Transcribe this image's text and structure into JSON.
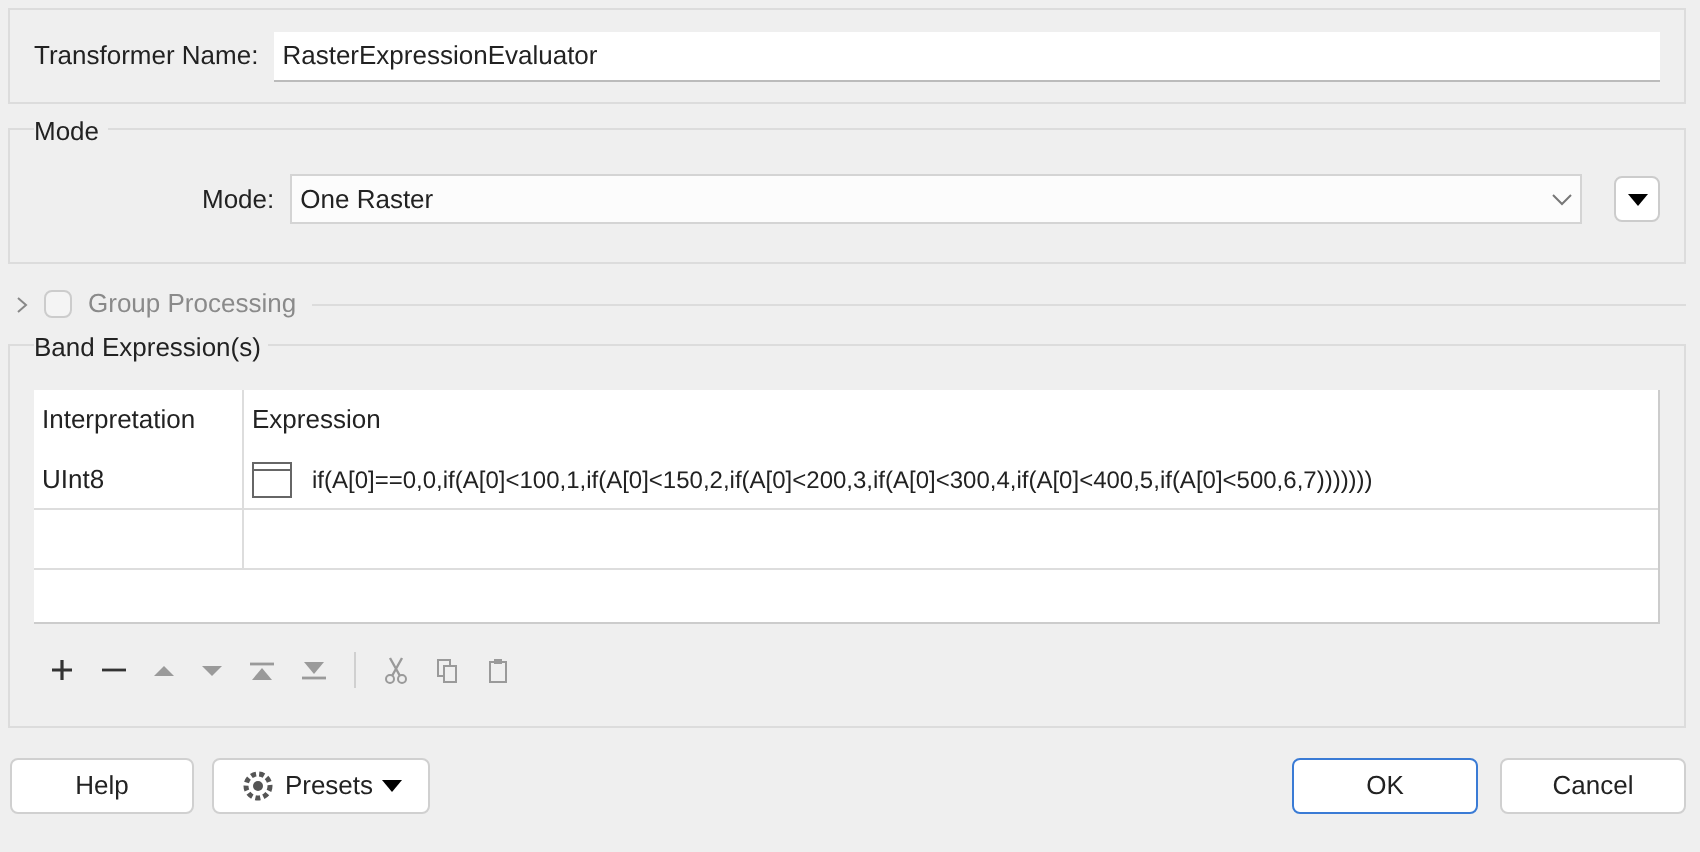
{
  "transformer_name": {
    "label": "Transformer Name:",
    "value": "RasterExpressionEvaluator"
  },
  "mode_group": {
    "title": "Mode",
    "label": "Mode:",
    "value": "One Raster"
  },
  "group_processing": {
    "label": "Group Processing",
    "expanded": false,
    "checked": false,
    "disabled": true
  },
  "band_group": {
    "title": "Band Expression(s)",
    "table": {
      "columns": [
        "Interpretation",
        "Expression"
      ],
      "rows": [
        {
          "interpretation": "UInt8",
          "expression": "if(A[0]==0,0,if(A[0]<100,1,if(A[0]<150,2,if(A[0]<200,3,if(A[0]<300,4,if(A[0]<400,5,if(A[0]<500,6,7)))))))"
        }
      ]
    },
    "toolbar": [
      {
        "kind": "add",
        "disabled": false
      },
      {
        "kind": "remove",
        "disabled": false
      },
      {
        "kind": "up",
        "disabled": true
      },
      {
        "kind": "down",
        "disabled": true
      },
      {
        "kind": "top",
        "disabled": true
      },
      {
        "kind": "bottom",
        "disabled": true
      },
      {
        "kind": "separator"
      },
      {
        "kind": "cut",
        "disabled": true
      },
      {
        "kind": "copy",
        "disabled": true
      },
      {
        "kind": "paste",
        "disabled": true
      }
    ]
  },
  "footer": {
    "help": "Help",
    "presets": "Presets",
    "ok": "OK",
    "cancel": "Cancel"
  }
}
